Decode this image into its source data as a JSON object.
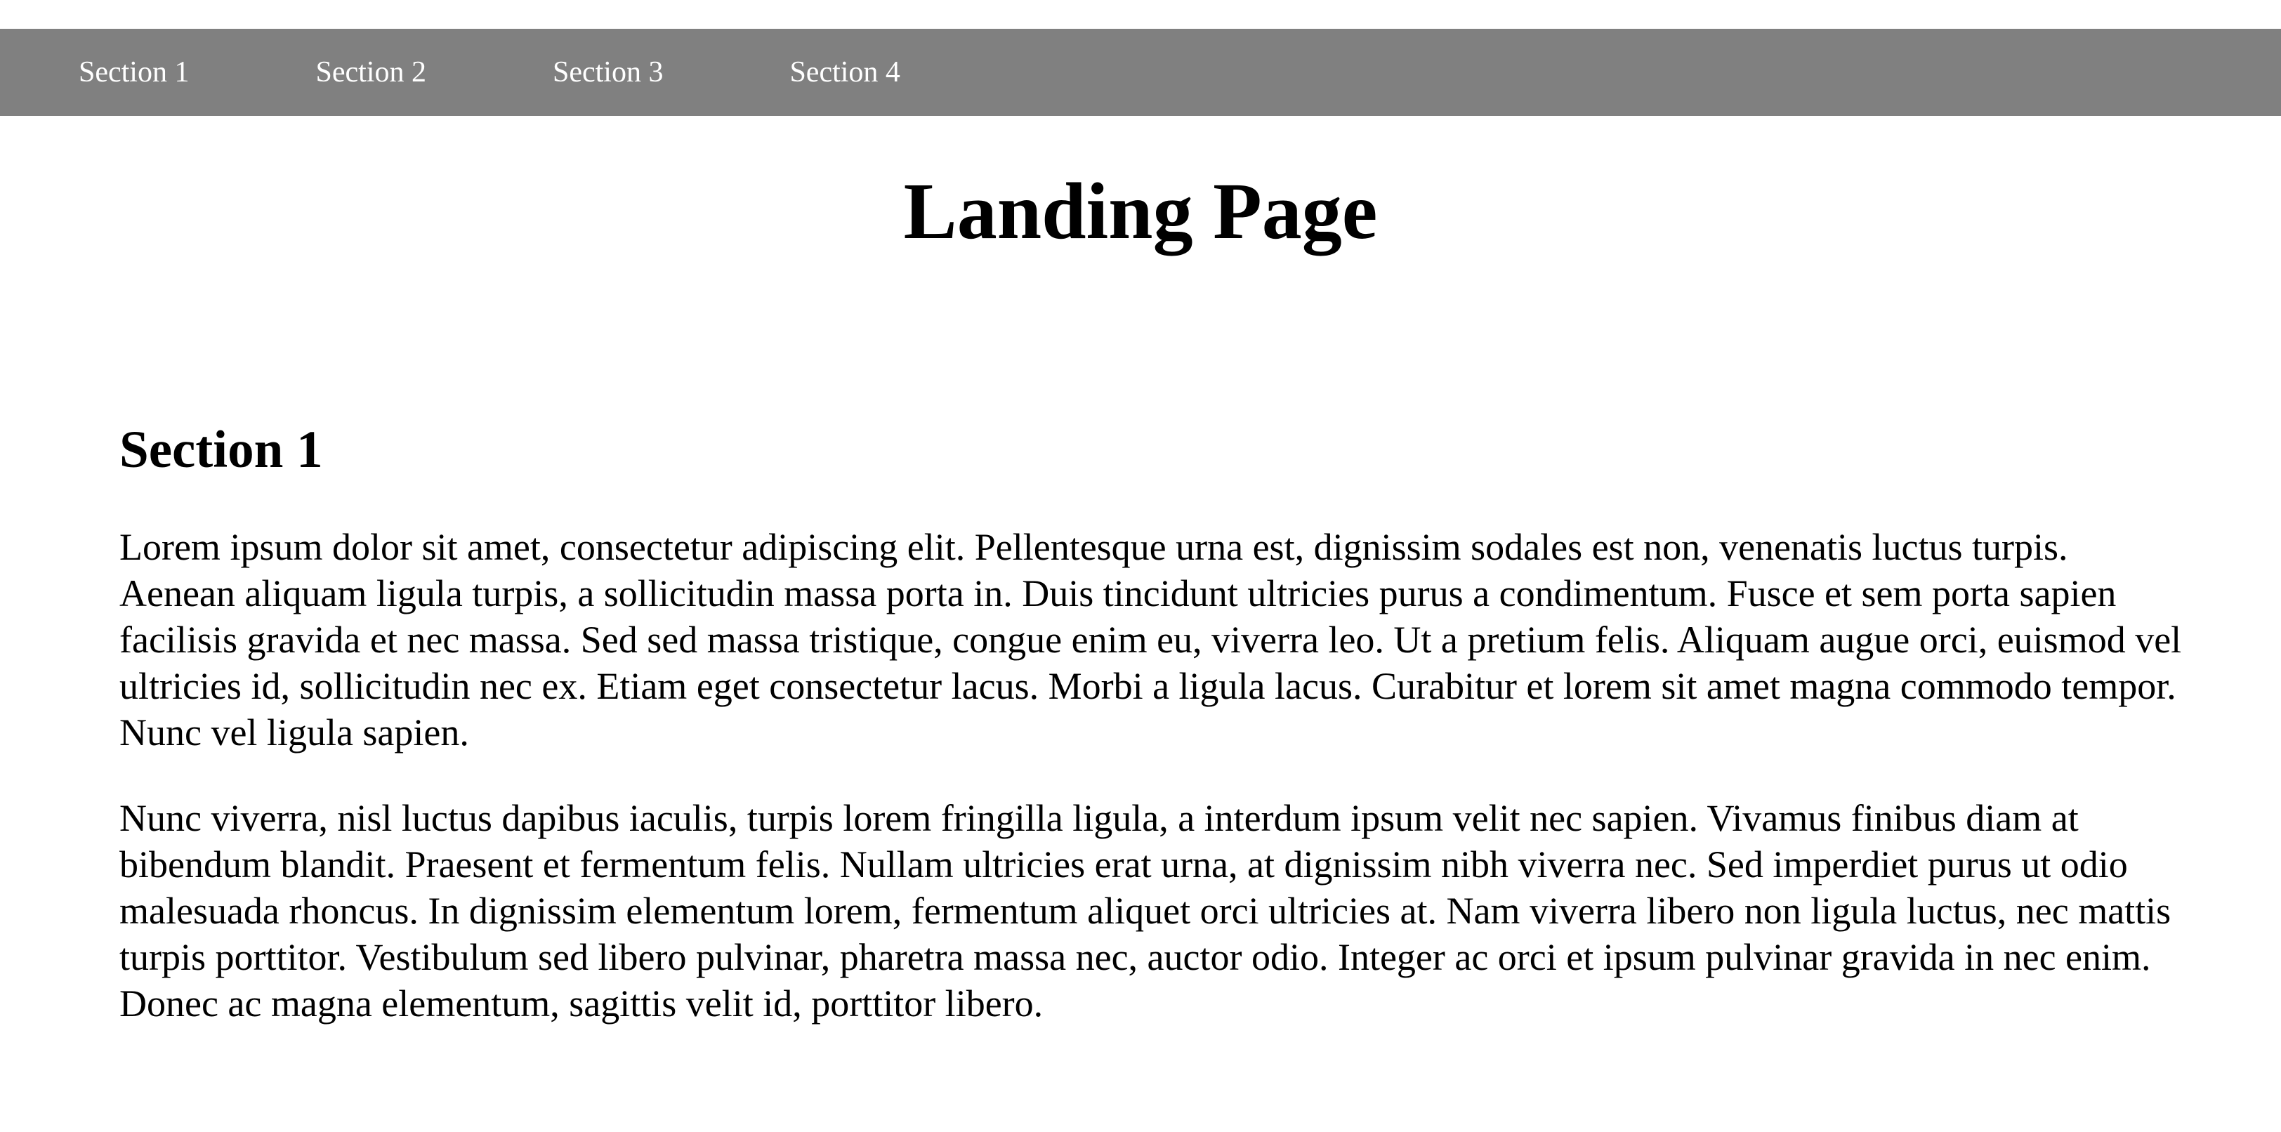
{
  "nav": {
    "items": [
      {
        "label": "Section 1"
      },
      {
        "label": "Section 2"
      },
      {
        "label": "Section 3"
      },
      {
        "label": "Section 4"
      }
    ],
    "background_color": "#808080",
    "text_color": "#ffffff"
  },
  "page_title": "Landing Page",
  "sections": [
    {
      "heading": "Section 1",
      "paragraphs": [
        "Lorem ipsum dolor sit amet, consectetur adipiscing elit. Pellentesque urna est, dignissim sodales est non, venenatis luctus turpis. Aenean aliquam ligula turpis, a sollicitudin massa porta in. Duis tincidunt ultricies purus a condimentum. Fusce et sem porta sapien facilisis gravida et nec massa. Sed sed massa tristique, congue enim eu, viverra leo. Ut a pretium felis. Aliquam augue orci, euismod vel ultricies id, sollicitudin nec ex. Etiam eget consectetur lacus. Morbi a ligula lacus. Curabitur et lorem sit amet magna commodo tempor. Nunc vel ligula sapien.",
        "Nunc viverra, nisl luctus dapibus iaculis, turpis lorem fringilla ligula, a interdum ipsum velit nec sapien. Vivamus finibus diam at bibendum blandit. Praesent et fermentum felis. Nullam ultricies erat urna, at dignissim nibh viverra nec. Sed imperdiet purus ut odio malesuada rhoncus. In dignissim elementum lorem, fermentum aliquet orci ultricies at. Nam viverra libero non ligula luctus, nec mattis turpis porttitor. Vestibulum sed libero pulvinar, pharetra massa nec, auctor odio. Integer ac orci et ipsum pulvinar gravida in nec enim. Donec ac magna elementum, sagittis velit id, porttitor libero."
      ]
    }
  ]
}
